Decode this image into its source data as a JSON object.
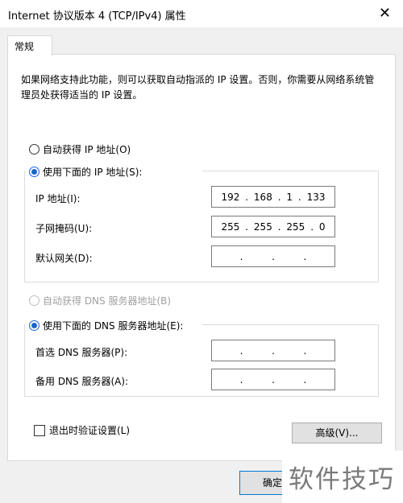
{
  "window": {
    "title": "Internet 协议版本 4 (TCP/IPv4) 属性",
    "close_glyph": "✕"
  },
  "tab": {
    "label": "常规"
  },
  "description": "如果网络支持此功能，则可以获取自动指派的 IP 设置。否则，你需要从网络系统管理员处获得适当的 IP 设置。",
  "ip_section": {
    "auto_label": "自动获得 IP 地址(O)",
    "manual_label": "使用下面的 IP 地址(S):",
    "selected": "manual",
    "ip_address_label": "IP 地址(I):",
    "ip_address": [
      "192",
      "168",
      "1",
      "133"
    ],
    "subnet_label": "子网掩码(U):",
    "subnet": [
      "255",
      "255",
      "255",
      "0"
    ],
    "gateway_label": "默认网关(D):",
    "gateway": [
      "",
      "",
      "",
      ""
    ]
  },
  "dns_section": {
    "auto_label": "自动获得 DNS 服务器地址(B)",
    "manual_label": "使用下面的 DNS 服务器地址(E):",
    "selected": "manual",
    "preferred_label": "首选 DNS 服务器(P):",
    "preferred": [
      "",
      "",
      "",
      ""
    ],
    "alternate_label": "备用 DNS 服务器(A):",
    "alternate": [
      "",
      "",
      "",
      ""
    ]
  },
  "validate_label": "退出时验证设置(L)",
  "advanced_button": "高级(V)...",
  "ok_button": "确定",
  "watermark": "软件技巧",
  "dot": "."
}
